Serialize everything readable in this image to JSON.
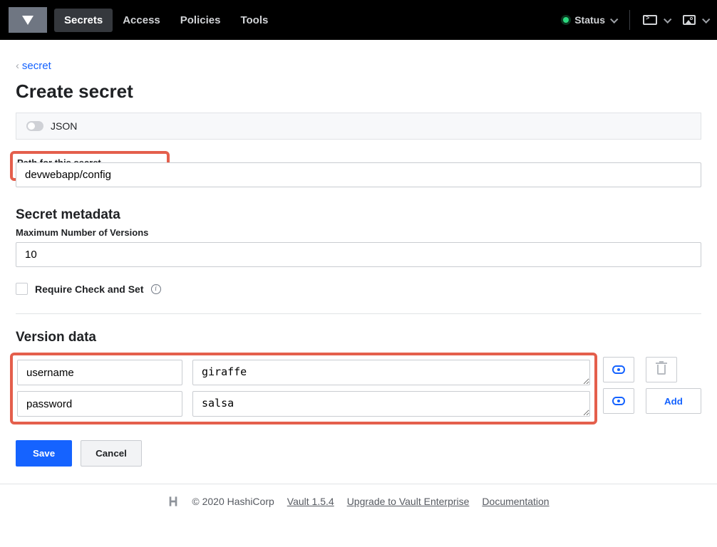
{
  "nav": {
    "items": [
      "Secrets",
      "Access",
      "Policies",
      "Tools"
    ],
    "active": "Secrets",
    "status_label": "Status"
  },
  "breadcrumb": {
    "back_label": "secret"
  },
  "page": {
    "heading": "Create secret"
  },
  "json_toggle": {
    "label": "JSON",
    "on": false
  },
  "path_section": {
    "label": "Path for this secret",
    "value": "devwebapp/config"
  },
  "metadata": {
    "heading": "Secret metadata",
    "max_versions_label": "Maximum Number of Versions",
    "max_versions_value": "10",
    "require_cas_label": "Require Check and Set"
  },
  "version_data": {
    "heading": "Version data",
    "rows": [
      {
        "key": "username",
        "value": "giraffe"
      },
      {
        "key": "password",
        "value": "salsa"
      }
    ],
    "add_label": "Add"
  },
  "actions": {
    "save": "Save",
    "cancel": "Cancel"
  },
  "footer": {
    "copyright": "© 2020 HashiCorp",
    "version": "Vault 1.5.4",
    "upgrade": "Upgrade to Vault Enterprise",
    "docs": "Documentation"
  }
}
